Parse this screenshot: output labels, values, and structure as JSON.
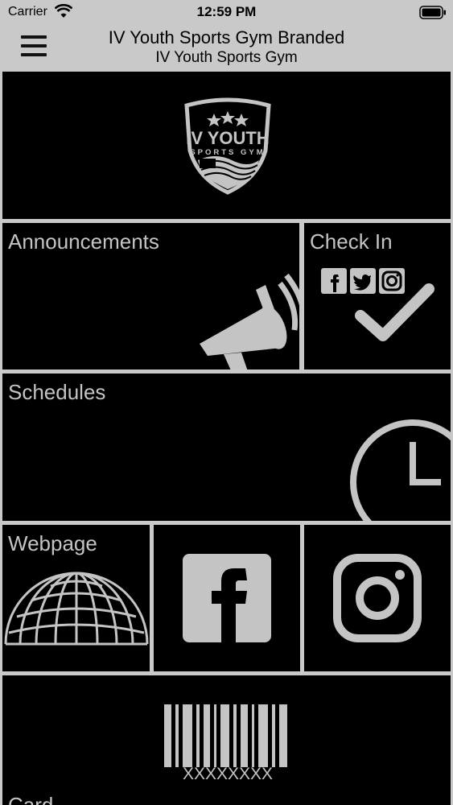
{
  "status_bar": {
    "carrier": "Carrier",
    "time": "12:59 PM"
  },
  "nav": {
    "title": "IV Youth Sports Gym Branded",
    "subtitle": "IV Youth Sports Gym",
    "menu_icon": "hamburger-menu-icon"
  },
  "logo": {
    "line1": "IV YOUTH",
    "line2": "SPORTS GYM"
  },
  "tiles": {
    "announcements": {
      "label": "Announcements",
      "icon": "megaphone-icon"
    },
    "checkin": {
      "label": "Check In",
      "icon": "checkmark-icon"
    },
    "schedules": {
      "label": "Schedules",
      "icon": "clock-icon"
    },
    "webpage": {
      "label": "Webpage",
      "icon": "globe-icon"
    },
    "facebook": {
      "icon": "facebook-icon"
    },
    "instagram": {
      "icon": "instagram-icon"
    },
    "card": {
      "label": "Card",
      "barcode_text": "XXXXXXXX",
      "icon": "barcode-icon"
    }
  },
  "colors": {
    "background": "#c9c9c9",
    "tile": "#000000",
    "tile_foreground": "#c4c4c4"
  }
}
